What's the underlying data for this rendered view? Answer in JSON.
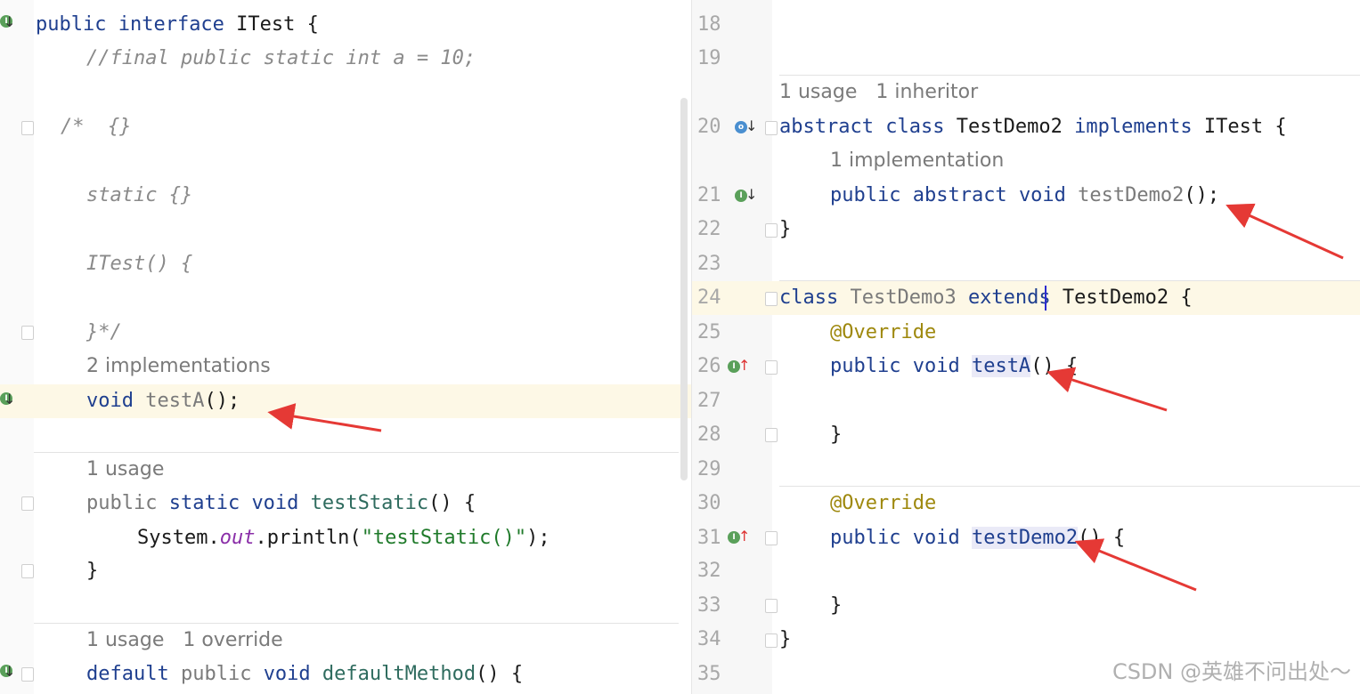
{
  "watermark": "CSDN @英雄不问出处～",
  "left_editor": {
    "lines": [
      {
        "id": "l1",
        "tokens": [
          {
            "t": "public ",
            "c": "kw"
          },
          {
            "t": "interface ",
            "c": "kw"
          },
          {
            "t": "ITest {",
            "c": ""
          }
        ]
      },
      {
        "id": "l2",
        "tokens": [
          {
            "t": "//final public static int a = 10;",
            "c": "cm"
          }
        ]
      },
      {
        "id": "l4",
        "tokens": [
          {
            "t": "/*  {}",
            "c": "cm"
          }
        ]
      },
      {
        "id": "l6",
        "tokens": [
          {
            "t": "static {}",
            "c": "cm"
          }
        ]
      },
      {
        "id": "l8",
        "tokens": [
          {
            "t": "ITest() {",
            "c": "cm"
          }
        ]
      },
      {
        "id": "l10",
        "tokens": [
          {
            "t": "}*/",
            "c": "cm"
          }
        ]
      },
      {
        "id": "l12",
        "tokens": [
          {
            "t": "void ",
            "c": "kw"
          },
          {
            "t": "testA",
            "c": "mg"
          },
          {
            "t": "();",
            "c": ""
          }
        ]
      },
      {
        "id": "l15",
        "tokens": [
          {
            "t": "public ",
            "c": "mg"
          },
          {
            "t": "static ",
            "c": "kw"
          },
          {
            "t": "void ",
            "c": "kw"
          },
          {
            "t": "testStatic",
            "c": "fn"
          },
          {
            "t": "() {",
            "c": ""
          }
        ]
      },
      {
        "id": "l16",
        "tokens": [
          {
            "t": "System.",
            "c": ""
          },
          {
            "t": "out",
            "c": "fld"
          },
          {
            "t": ".println(",
            "c": ""
          },
          {
            "t": "\"testStatic()\"",
            "c": "str"
          },
          {
            "t": ");",
            "c": ""
          }
        ]
      },
      {
        "id": "l17",
        "tokens": [
          {
            "t": "}",
            "c": ""
          }
        ]
      },
      {
        "id": "l20",
        "tokens": [
          {
            "t": "default ",
            "c": "kw"
          },
          {
            "t": "public ",
            "c": "mg"
          },
          {
            "t": "void ",
            "c": "kw"
          },
          {
            "t": "defaultMethod",
            "c": "fn"
          },
          {
            "t": "() {",
            "c": ""
          }
        ]
      }
    ],
    "hints": {
      "h11": "2 implementations",
      "h14": "1 usage",
      "h19": "1 usage   1 override"
    }
  },
  "right_editor": {
    "line_numbers": [
      "18",
      "19",
      "20",
      "21",
      "22",
      "23",
      "24",
      "25",
      "26",
      "27",
      "28",
      "29",
      "30",
      "31",
      "32",
      "33",
      "34",
      "35"
    ],
    "lines": [
      {
        "id": "r20",
        "tokens": [
          {
            "t": "abstract ",
            "c": "kw"
          },
          {
            "t": "class ",
            "c": "kw"
          },
          {
            "t": "TestDemo2 ",
            "c": ""
          },
          {
            "t": "implements ",
            "c": "kw"
          },
          {
            "t": "ITest {",
            "c": ""
          }
        ]
      },
      {
        "id": "r21",
        "tokens": [
          {
            "t": "public ",
            "c": "kw"
          },
          {
            "t": "abstract ",
            "c": "kw"
          },
          {
            "t": "void ",
            "c": "kw"
          },
          {
            "t": "testDemo2",
            "c": "mg"
          },
          {
            "t": "();",
            "c": ""
          }
        ]
      },
      {
        "id": "r22",
        "tokens": [
          {
            "t": "}",
            "c": ""
          }
        ]
      },
      {
        "id": "r24",
        "tokens": [
          {
            "t": "class ",
            "c": "kw"
          },
          {
            "t": "TestDemo3 ",
            "c": "mg"
          },
          {
            "t": "extends ",
            "c": "kw"
          },
          {
            "t": "TestDemo2 {",
            "c": ""
          }
        ]
      },
      {
        "id": "r25",
        "tokens": [
          {
            "t": "@Override",
            "c": "ann"
          }
        ]
      },
      {
        "id": "r26",
        "tokens": [
          {
            "t": "public ",
            "c": "kw"
          },
          {
            "t": "void ",
            "c": "kw"
          },
          {
            "t": "testA",
            "c": "kw idh"
          },
          {
            "t": "() {",
            "c": ""
          }
        ]
      },
      {
        "id": "r28",
        "tokens": [
          {
            "t": "}",
            "c": ""
          }
        ]
      },
      {
        "id": "r30",
        "tokens": [
          {
            "t": "@Override",
            "c": "ann"
          }
        ]
      },
      {
        "id": "r31",
        "tokens": [
          {
            "t": "public ",
            "c": "kw"
          },
          {
            "t": "void ",
            "c": "kw"
          },
          {
            "t": "testDemo2",
            "c": "kw idh"
          },
          {
            "t": "() {",
            "c": ""
          }
        ]
      },
      {
        "id": "r33",
        "tokens": [
          {
            "t": "}",
            "c": ""
          }
        ]
      },
      {
        "id": "r34",
        "tokens": [
          {
            "t": "}",
            "c": ""
          }
        ]
      }
    ],
    "hints": {
      "h19b": "1 usage   1 inheritor",
      "h20b": "1 implementation"
    }
  },
  "icons": {
    "implemented": "implemented-icon",
    "overrides": "overrides-icon"
  }
}
